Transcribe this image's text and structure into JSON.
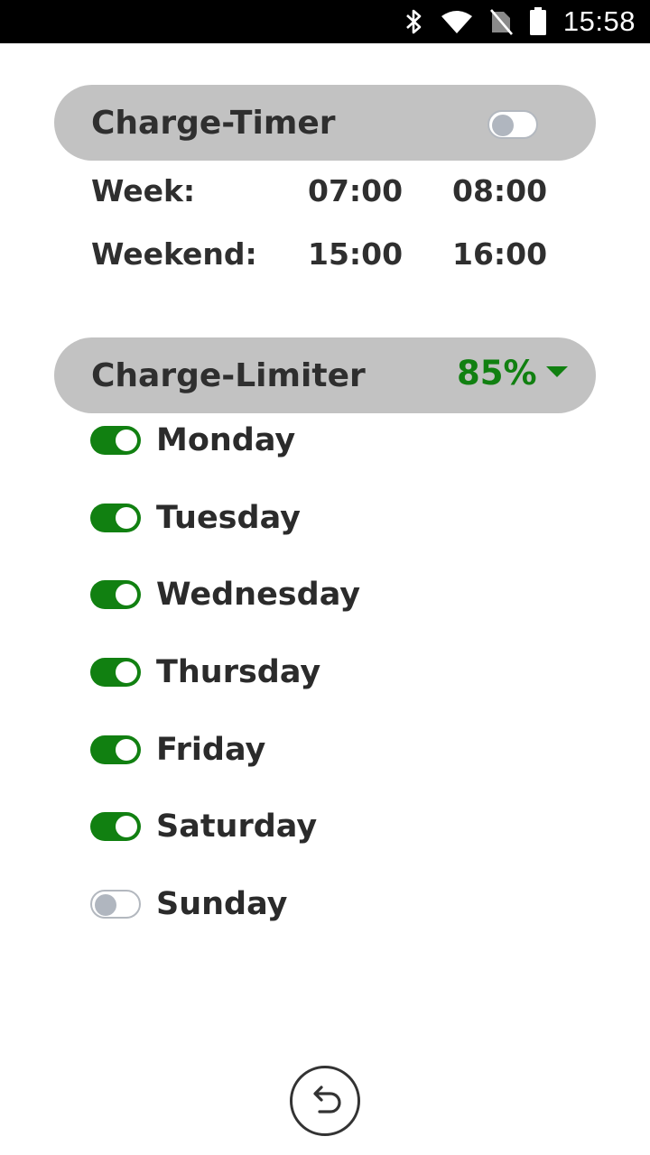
{
  "status_bar": {
    "time": "15:58",
    "icons": [
      "bluetooth-icon",
      "wifi-icon",
      "no-sim-icon",
      "battery-icon"
    ]
  },
  "charge_timer": {
    "title": "Charge-Timer",
    "enabled": false,
    "rows": [
      {
        "label": "Week:",
        "start": "07:00",
        "end": "08:00"
      },
      {
        "label": "Weekend:",
        "start": "15:00",
        "end": "16:00"
      }
    ]
  },
  "charge_limiter": {
    "title": "Charge-Limiter",
    "value": "85%",
    "accent_color": "#118011",
    "days": [
      {
        "label": "Monday",
        "enabled": true
      },
      {
        "label": "Tuesday",
        "enabled": true
      },
      {
        "label": "Wednesday",
        "enabled": true
      },
      {
        "label": "Thursday",
        "enabled": true
      },
      {
        "label": "Friday",
        "enabled": true
      },
      {
        "label": "Saturday",
        "enabled": true
      },
      {
        "label": "Sunday",
        "enabled": false
      }
    ]
  },
  "navigation": {
    "back_icon": "back-arrow-icon"
  }
}
